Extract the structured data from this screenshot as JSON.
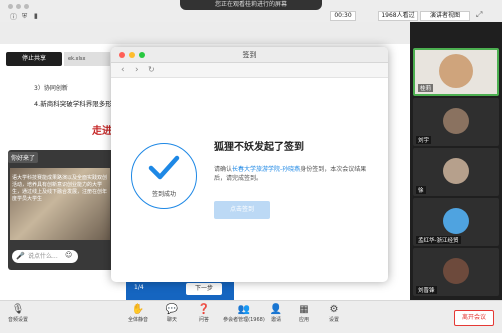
{
  "top_bar": {
    "sharing_status": "您正在观看桂莉进行的屏幕",
    "timer": "00:30",
    "viewers": "1968人看过",
    "gallery_view": "演讲者视图"
  },
  "share": {
    "stop_share_label": "停止共享",
    "browser_tab": "ek.xlsx",
    "doc_line_1": "3）协同创新",
    "doc_line_2": "4.新商科突破学科界限多形态",
    "red_title": "走进",
    "chat_header": "你好来了",
    "chat_text": "语大学科技赛能成果路演以及全面实践双创活动，培养具有创新意识创业能力的大学生，通过线上及线下融合发展，注册在创年度学员大学生",
    "chat_placeholder": "说点什么...",
    "page_num": "1/4",
    "next_page": "下一步"
  },
  "dialog": {
    "window_title": "签到",
    "success_label": "签到成功",
    "heading": "狐狸不妖发起了签到",
    "desc_prefix": "请确认",
    "desc_link": "长春大学旅游学院-孙晓燕",
    "desc_suffix": "身份签到，本次会议结果后，请完成签到。",
    "signin_button": "点击签到"
  },
  "participants": [
    {
      "name": "桂莉",
      "color": "#cfa47c"
    },
    {
      "name": "刘宇",
      "color": "#8a7260"
    },
    {
      "name": "徐",
      "color": "#b6a08c"
    },
    {
      "name": "孟红华-浙江经贸",
      "color": "#4fa3e0"
    },
    {
      "name": "刘晋锋",
      "color": "#6d4a3c"
    }
  ],
  "toolbar": {
    "audio": "音频设置",
    "mute_all": "全体静音",
    "chat": "聊天",
    "qa": "问答",
    "participants": "参会者管理(1968)",
    "invite": "邀请",
    "apps": "应用",
    "settings": "设置",
    "end": "离开会议"
  },
  "colors": {
    "accent": "#1e88e5",
    "end_red": "#e53935",
    "title_red": "#c62828"
  }
}
